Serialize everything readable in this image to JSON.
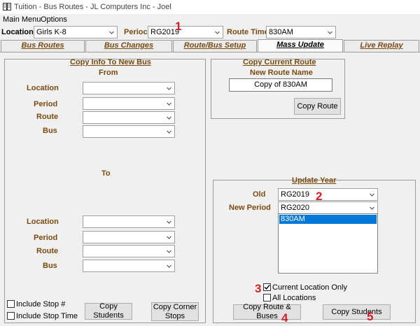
{
  "window": {
    "title": "Tuition - Bus Routes - JL Computers Inc - Joel"
  },
  "menu": [
    "Main Menu",
    "Options"
  ],
  "filters": {
    "location_label": "Location",
    "location_value": "Girls K-8",
    "period_label": "Perioc",
    "period_value": "RG2019",
    "route_time_label": "Route Time",
    "route_time_value": "830AM"
  },
  "tabs": [
    "Bus Routes",
    "Bus Changes",
    "Route/Bus Setup",
    "Mass Update",
    "Live Replay"
  ],
  "copy_info": {
    "title": "Copy Info To New Bus",
    "from_label": "From",
    "to_label": "To",
    "from_fields": [
      "Location",
      "Period",
      "Route",
      "Bus"
    ],
    "to_fields": [
      "Location",
      "Period",
      "Route",
      "Bus"
    ],
    "include_stop_label": "Include Stop #",
    "include_stop_time_label": "Include Stop Time",
    "copy_students_label": "Copy Students",
    "copy_corner_stops_label": "Copy Corner Stops"
  },
  "copy_route": {
    "title": "Copy Current Route",
    "new_route_name_label": "New Route Name",
    "new_route_name_value": "Copy of 830AM",
    "button_label": "Copy Route"
  },
  "update_year": {
    "title": "Update Year",
    "old_label": "Old",
    "old_value": "RG2019",
    "new_period_label": "New Period",
    "new_period_value": "RG2020",
    "routes": [
      "830AM"
    ],
    "current_location_only_label": "Current Location Only",
    "current_location_only_checked": true,
    "all_locations_label": "All Locations",
    "all_locations_checked": false,
    "copy_route_buses_label": "Copy Route & Buses",
    "copy_students_label": "Copy Students"
  },
  "markers": [
    "1",
    "2",
    "3",
    "4",
    "5"
  ],
  "colors": {
    "accent_brown": "#7a4a10",
    "selection": "#0078d7",
    "marker_red": "#d0202a"
  }
}
